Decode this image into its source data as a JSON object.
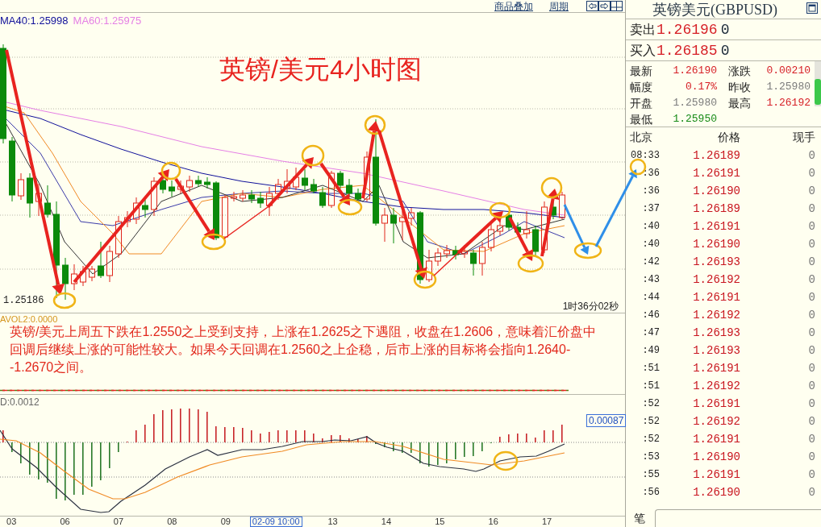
{
  "toolbar": {
    "links": [
      "商品叠加",
      "周期"
    ]
  },
  "price_chart": {
    "ma_labels": [
      {
        "text": "MA40:1.25998",
        "color": "#10109a"
      },
      {
        "text": "MA60:1.25975",
        "color": "#e57fe5"
      }
    ],
    "title": "英镑/美元4小时图",
    "low_label": "1.25186",
    "elapsed": "1时36分02秒"
  },
  "commentary": {
    "indicator_label": "AVOL2:0.0000",
    "text": "英镑/美元上周五下跌在1.2550之上受到支持，上涨在1.2625之下遇阻，收盘在1.2606，意味着汇价盘中回调后继续上涨的可能性较大。如果今天回调在1.2560之上企稳，后市上涨的目标将会指向1.2640--1.2670之间。"
  },
  "macd": {
    "label": "D:0.0012",
    "value_box": "0.00087"
  },
  "x_axis": [
    {
      "kind": "tick",
      "text": "03"
    },
    {
      "kind": "tick",
      "text": "06"
    },
    {
      "kind": "tick",
      "text": "07"
    },
    {
      "kind": "tick",
      "text": "08"
    },
    {
      "kind": "tick",
      "text": "09"
    },
    {
      "kind": "cursor",
      "text": "02-09 10:00"
    },
    {
      "kind": "tick",
      "text": "13"
    },
    {
      "kind": "tick",
      "text": "14"
    },
    {
      "kind": "tick",
      "text": "15"
    },
    {
      "kind": "tick",
      "text": "16"
    },
    {
      "kind": "tick",
      "text": "17"
    }
  ],
  "quote_panel": {
    "title": "英镑美元(GBPUSD)",
    "orders": [
      {
        "label": "卖出",
        "price": "1.26196",
        "volume": "0"
      },
      {
        "label": "买入",
        "price": "1.26185",
        "volume": "0"
      }
    ],
    "stats": [
      {
        "label": "最新",
        "value": "1.26190",
        "color": "#d61f26"
      },
      {
        "label": "涨跌",
        "value": "0.00210",
        "color": "#d61f26"
      },
      {
        "label": "幅度",
        "value": "0.17%",
        "color": "#d61f26"
      },
      {
        "label": "昨收",
        "value": "1.25980",
        "color": "#7c7c7c"
      },
      {
        "label": "开盘",
        "value": "1.25980",
        "color": "#7c7c7c"
      },
      {
        "label": "最高",
        "value": "1.26192",
        "color": "#d61f26"
      },
      {
        "label": "最低",
        "value": "1.25950",
        "color": "#168a16"
      }
    ],
    "trades": {
      "columns": [
        "北京",
        "价格",
        "现手"
      ],
      "rows": [
        {
          "time": "08:33",
          "price": "1.26189",
          "volume": "0"
        },
        {
          "time": ":36",
          "price": "1.26191",
          "volume": "0"
        },
        {
          "time": ":36",
          "price": "1.26190",
          "volume": "0"
        },
        {
          "time": ":37",
          "price": "1.26189",
          "volume": "0"
        },
        {
          "time": ":40",
          "price": "1.26191",
          "volume": "0"
        },
        {
          "time": ":40",
          "price": "1.26190",
          "volume": "0"
        },
        {
          "time": ":42",
          "price": "1.26193",
          "volume": "0"
        },
        {
          "time": ":43",
          "price": "1.26192",
          "volume": "0"
        },
        {
          "time": ":44",
          "price": "1.26191",
          "volume": "0"
        },
        {
          "time": ":46",
          "price": "1.26192",
          "volume": "0"
        },
        {
          "time": ":47",
          "price": "1.26193",
          "volume": "0"
        },
        {
          "time": ":49",
          "price": "1.26193",
          "volume": "0"
        },
        {
          "time": ":51",
          "price": "1.26191",
          "volume": "0"
        },
        {
          "time": ":51",
          "price": "1.26192",
          "volume": "0"
        },
        {
          "time": ":52",
          "price": "1.26191",
          "volume": "0"
        },
        {
          "time": ":52",
          "price": "1.26192",
          "volume": "0"
        },
        {
          "time": ":52",
          "price": "1.26191",
          "volume": "0"
        },
        {
          "time": ":53",
          "price": "1.26190",
          "volume": "0"
        },
        {
          "time": ":55",
          "price": "1.26191",
          "volume": "0"
        },
        {
          "time": ":56",
          "price": "1.26190",
          "volume": "0"
        }
      ]
    },
    "footer_tab": "笔"
  }
}
